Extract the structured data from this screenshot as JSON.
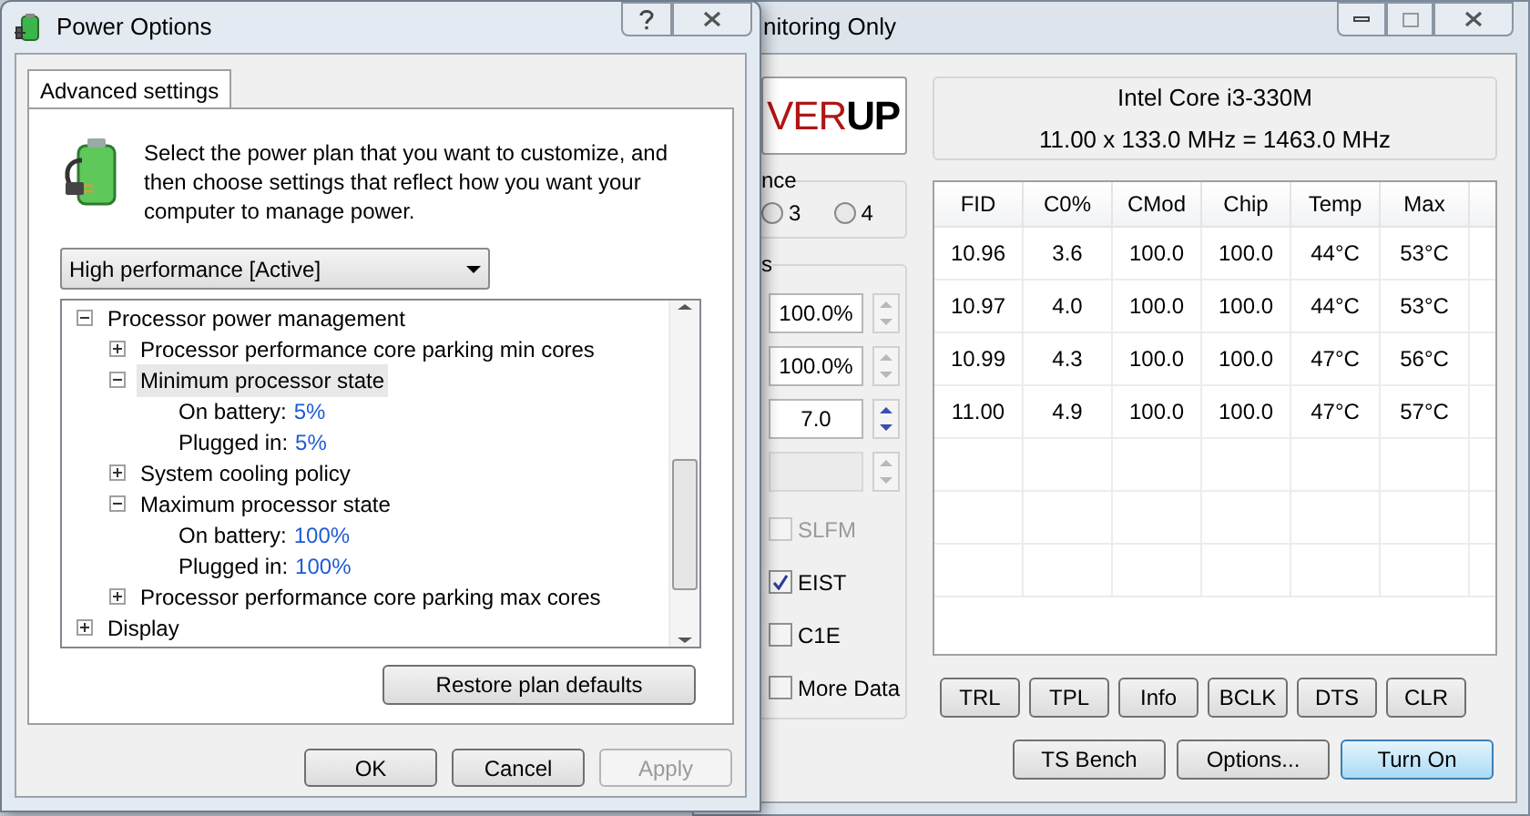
{
  "back_window": {
    "title": "nitoring Only",
    "logo": {
      "part_1": "VER",
      "part_2": "UP"
    },
    "group_1": {
      "label": "nce",
      "radios": [
        {
          "label": "3",
          "selected": false
        },
        {
          "label": "4",
          "selected": false
        }
      ]
    },
    "group_2": {
      "label": "s",
      "spinners": [
        {
          "value": "100.0%",
          "disabled": false,
          "arrows_enabled": false
        },
        {
          "value": "100.0%",
          "disabled": false,
          "arrows_enabled": false
        },
        {
          "value": "7.0",
          "disabled": false,
          "arrows_enabled": true
        },
        {
          "disabled": true,
          "arrows_enabled": false
        }
      ],
      "checkboxes": [
        {
          "label": "SLFM",
          "checked": false,
          "disabled": true
        },
        {
          "label": "EIST",
          "checked": true,
          "disabled": false
        },
        {
          "label": "C1E",
          "checked": false,
          "disabled": false
        },
        {
          "label": "More Data",
          "checked": false,
          "disabled": false
        }
      ]
    },
    "cpu_info": {
      "name": "Intel Core i3-330M",
      "frequency": "11.00 x 133.0 MHz = 1463.0 MHz"
    },
    "table": {
      "columns": [
        "FID",
        "C0%",
        "CMod",
        "Chip",
        "Temp",
        "Max"
      ],
      "rows": [
        [
          "10.96",
          "3.6",
          "100.0",
          "100.0",
          "44°C",
          "53°C"
        ],
        [
          "10.97",
          "4.0",
          "100.0",
          "100.0",
          "44°C",
          "53°C"
        ],
        [
          "10.99",
          "4.3",
          "100.0",
          "100.0",
          "47°C",
          "56°C"
        ],
        [
          "11.00",
          "4.9",
          "100.0",
          "100.0",
          "47°C",
          "57°C"
        ]
      ]
    },
    "tool_buttons": [
      "TRL",
      "TPL",
      "Info",
      "BCLK",
      "DTS",
      "CLR"
    ],
    "action_buttons": [
      {
        "label": "TS Bench",
        "default": false
      },
      {
        "label": "Options...",
        "default": false
      },
      {
        "label": "Turn On",
        "default": true
      }
    ]
  },
  "front_window": {
    "title": "Power Options",
    "tabs": [
      {
        "label": "Advanced settings",
        "selected": true
      }
    ],
    "description": "Select the power plan that you want to customize, and then choose settings that reflect how you want your computer to manage power.",
    "plan_select": {
      "value": "High performance [Active]"
    },
    "tree": [
      {
        "kind": "group",
        "label": "Processor power management",
        "expanded": true,
        "selected": false,
        "children": [
          {
            "kind": "group",
            "label": "Processor performance core parking min cores",
            "expanded": false,
            "selected": false
          },
          {
            "kind": "group",
            "label": "Minimum processor state",
            "expanded": true,
            "selected": true,
            "children": [
              {
                "kind": "setting",
                "label": "On battery:",
                "value": "5%"
              },
              {
                "kind": "setting",
                "label": "Plugged in:",
                "value": "5%"
              }
            ]
          },
          {
            "kind": "group",
            "label": "System cooling policy",
            "expanded": false,
            "selected": false
          },
          {
            "kind": "group",
            "label": "Maximum processor state",
            "expanded": true,
            "selected": false,
            "children": [
              {
                "kind": "setting",
                "label": "On battery:",
                "value": "100%"
              },
              {
                "kind": "setting",
                "label": "Plugged in:",
                "value": "100%"
              }
            ]
          },
          {
            "kind": "group",
            "label": "Processor performance core parking max cores",
            "expanded": false,
            "selected": false
          }
        ]
      },
      {
        "kind": "group",
        "label": "Display",
        "expanded": false,
        "selected": false
      }
    ],
    "restore_button": "Restore plan defaults",
    "buttons": [
      {
        "label": "OK",
        "disabled": false
      },
      {
        "label": "Cancel",
        "disabled": false
      },
      {
        "label": "Apply",
        "disabled": true
      }
    ]
  }
}
